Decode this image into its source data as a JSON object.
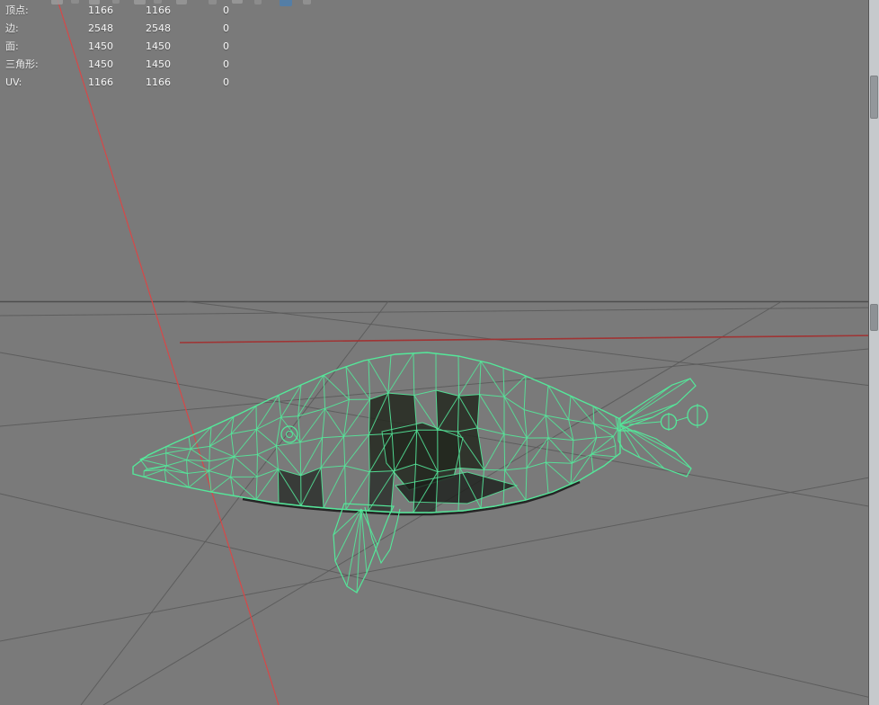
{
  "hud": {
    "rows": [
      {
        "label": "顶点:",
        "c1": "1166",
        "c2": "1166",
        "c3": "0"
      },
      {
        "label": "边:",
        "c1": "2548",
        "c2": "2548",
        "c3": "0"
      },
      {
        "label": "面:",
        "c1": "1450",
        "c2": "1450",
        "c3": "0"
      },
      {
        "label": "三角形:",
        "c1": "1450",
        "c2": "1450",
        "c3": "0"
      },
      {
        "label": "UV:",
        "c1": "1166",
        "c2": "1166",
        "c3": "0"
      }
    ]
  },
  "colors": {
    "background": "#7a7a7a",
    "wireframe_green": "#54e89a",
    "grid_line": "#5a5a5a",
    "horizon_line": "#4e4e4e",
    "axis_red": "#a03434",
    "curve_red": "#d64848",
    "dark_face": "#23281f",
    "belly_shadow": "#101010",
    "scrollbar_track": "#c6c9cc",
    "scrollbar_thumb": "#93979b",
    "hud_text": "#efefef",
    "toolbar_accent": "#4d7fae"
  }
}
